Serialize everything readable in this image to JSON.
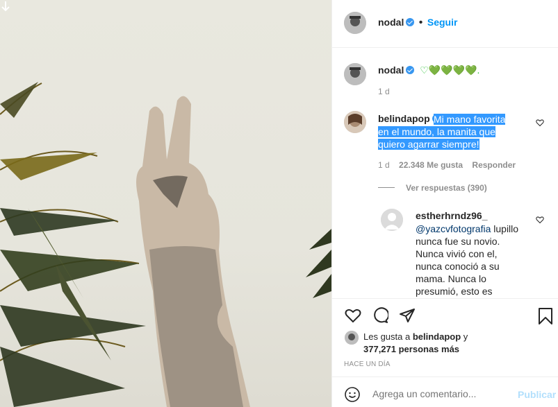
{
  "post": {
    "author": "nodal",
    "follow_label": "Seguir",
    "caption_emoji": "♡💚💚💚💚.",
    "caption_age": "1 d"
  },
  "comments": [
    {
      "user": "belindapop",
      "text_lines": [
        "Mi mano favorita",
        "en el mundo, la manita que",
        "quiero agarrar siempre!"
      ],
      "age": "1 d",
      "likes": "22.348 Me gusta",
      "reply_label": "Responder",
      "view_replies": "Ver respuestas (390)"
    },
    {
      "user": "estherhrndz96_",
      "mention": "@yazcvfotografia",
      "text_lines": [
        " lupillo",
        "nunca fue su novio.",
        "Nunca vivió con el,",
        "nunca conoció a su",
        "mama. Nunca lo",
        "presumió, esto es"
      ]
    }
  ],
  "likes_summary": {
    "prefix": "Les gusta a ",
    "user": "belindapop",
    "suffix": " y",
    "others": "377,271 personas más"
  },
  "timestamp": "HACE UN DÍA",
  "add_comment": {
    "placeholder": "Agrega un comentario...",
    "publish_label": "Publicar"
  },
  "colors": {
    "accent": "#0095f6",
    "verified": "#3897f0",
    "highlight": "#3399ff",
    "heart_green": "#1fbf2a"
  },
  "icons": [
    "download-arrow-icon",
    "verified-badge-icon",
    "heart-icon",
    "comment-icon",
    "share-icon",
    "bookmark-icon",
    "emoji-icon"
  ]
}
